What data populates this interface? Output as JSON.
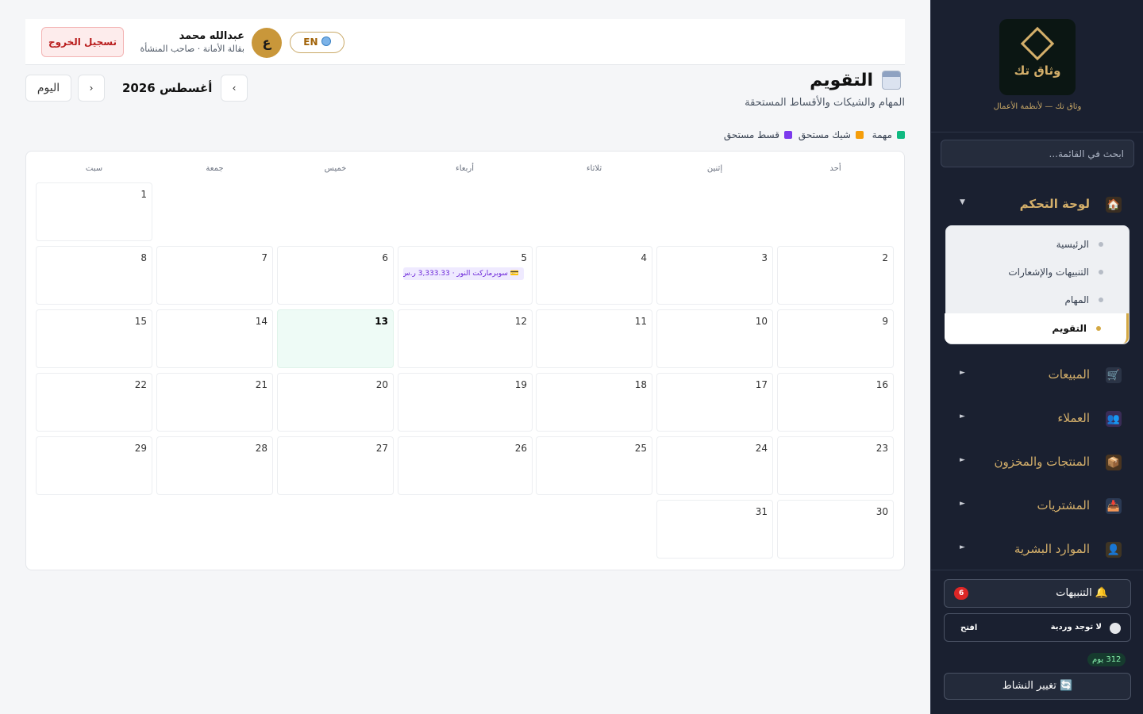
{
  "header": {
    "logout_label": "تسجيل الخروج",
    "user_name": "عبدالله محمد",
    "user_role": "بقالة الأمانة · صاحب المنشأة",
    "avatar_letter": "ع",
    "lang_label": "EN"
  },
  "page": {
    "title": "التقويم",
    "subtitle": "المهام والشيكات والأقساط المستحقة",
    "prev": "‹",
    "next": "›",
    "month_label": "أغسطس 2026",
    "today_label": "اليوم"
  },
  "legend": [
    {
      "label": "مهمة",
      "color": "#10b981"
    },
    {
      "label": "شيك مستحق",
      "color": "#f59e0b"
    },
    {
      "label": "قسط مستحق",
      "color": "#7c3aed"
    }
  ],
  "calendar": {
    "weekdays": [
      "أحد",
      "إثنين",
      "ثلاثاء",
      "أربعاء",
      "خميس",
      "جمعة",
      "سبت"
    ],
    "days": [
      "1",
      "2",
      "3",
      "4",
      "5",
      "6",
      "7",
      "8",
      "9",
      "10",
      "11",
      "12",
      "13",
      "14",
      "15",
      "16",
      "17",
      "18",
      "19",
      "20",
      "21",
      "22",
      "23",
      "24",
      "25",
      "26",
      "27",
      "28",
      "29",
      "30",
      "31"
    ],
    "today": "13",
    "event": {
      "day": "5",
      "text": "💳 سوبرماركت النور · 3,333.33 ر.س"
    }
  },
  "sidebar": {
    "logo_text": "وثاق تك",
    "tagline": "وثاق تك — لأنظمة الأعمال",
    "search_placeholder": "ابحث في القائمة...",
    "dashboard_label": "لوحة التحكم",
    "sub_items": [
      {
        "label": "الرئيسية"
      },
      {
        "label": "التنبيهات والإشعارات"
      },
      {
        "label": "المهام"
      },
      {
        "label": "التقويم"
      }
    ],
    "nav_items": [
      {
        "label": "المبيعات",
        "icon": "cart-icon"
      },
      {
        "label": "العملاء",
        "icon": "users-icon"
      },
      {
        "label": "المنتجات والمخزون",
        "icon": "box-icon"
      },
      {
        "label": "المشتريات",
        "icon": "inbox-icon"
      },
      {
        "label": "الموارد البشرية",
        "icon": "person-icon"
      }
    ],
    "alerts_label": "🔔 التنبيهات",
    "alerts_count": "6",
    "shift_label": "لا توجد وردية",
    "shift_open": "افتح",
    "days_label": "312 يوم",
    "switch_label": "🔄 تغيير النشاط"
  }
}
